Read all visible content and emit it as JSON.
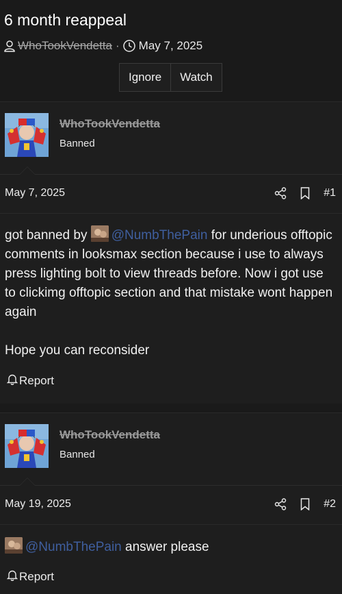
{
  "thread": {
    "title": "6 month reappeal",
    "author": "WhoTookVendetta",
    "separator": "·",
    "date": "May 7, 2025"
  },
  "actions": {
    "ignore": "Ignore",
    "watch": "Watch"
  },
  "posts": [
    {
      "username": "WhoTookVendetta",
      "user_title": "Banned",
      "date": "May 7, 2025",
      "number": "#1",
      "text_before": "got banned by ",
      "mention": "@NumbThePain",
      "text_after": " for underious offtopic comments in looksmax section because i use to always press lighting bolt to view threads before. Now i got use to clickimg offtopic section and that mistake wont happen again",
      "paragraph2": "Hope you can reconsider",
      "report": "Report"
    },
    {
      "username": "WhoTookVendetta",
      "user_title": "Banned",
      "date": "May 19, 2025",
      "number": "#2",
      "mention": "@NumbThePain",
      "text_after": " answer please",
      "report": "Report"
    }
  ],
  "colors": {
    "background": "#1a1a1a",
    "mention": "#3f5f9f",
    "struck_username": "#9a9a9a"
  },
  "icons": [
    "user-icon",
    "clock-icon",
    "share-icon",
    "bookmark-icon",
    "bell-icon"
  ]
}
